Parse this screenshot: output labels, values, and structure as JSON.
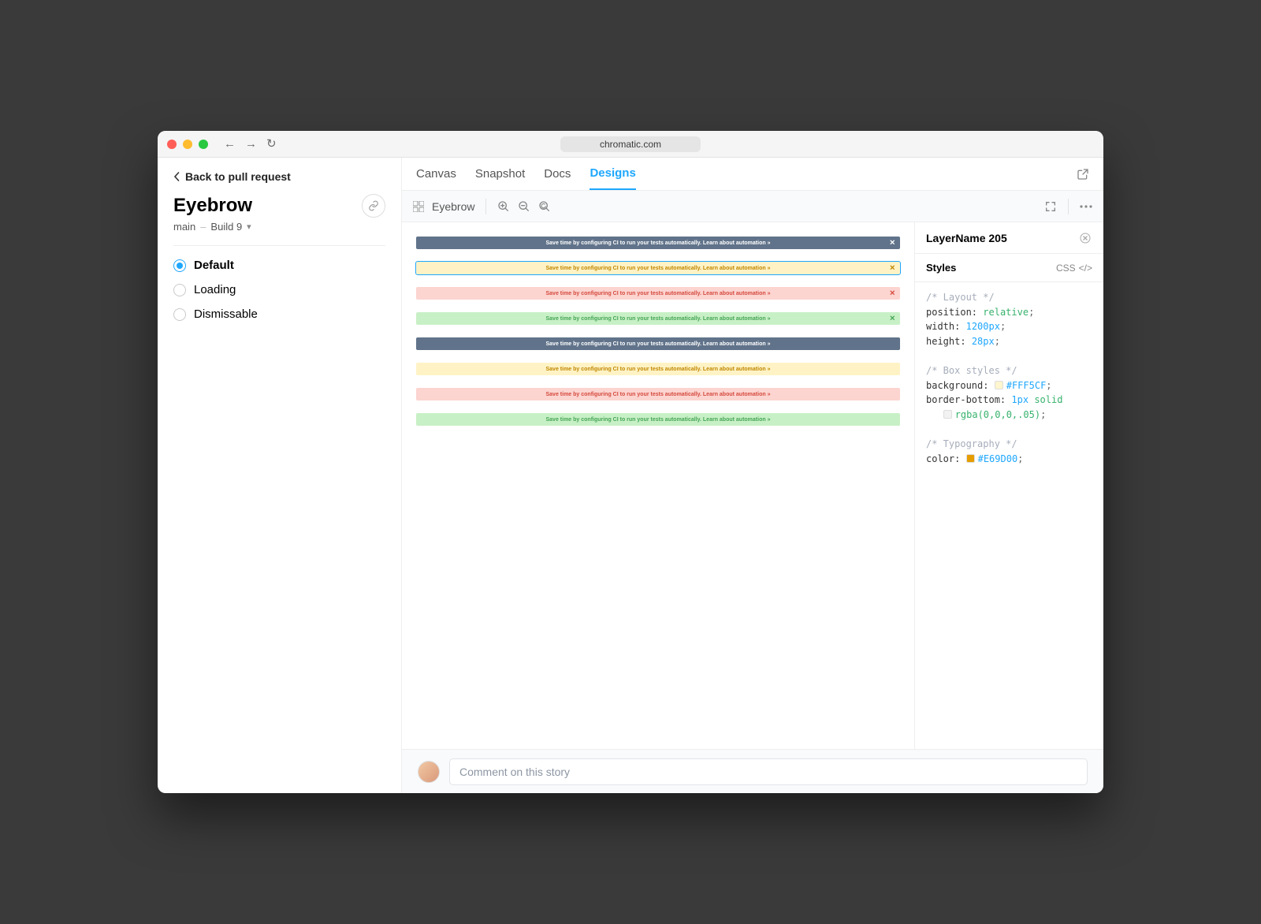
{
  "browser": {
    "url": "chromatic.com"
  },
  "sidebar": {
    "back_label": "Back to pull request",
    "title": "Eyebrow",
    "breadcrumb": {
      "branch": "main",
      "build": "Build 9"
    },
    "variants": [
      {
        "label": "Default",
        "selected": true
      },
      {
        "label": "Loading",
        "selected": false
      },
      {
        "label": "Dismissable",
        "selected": false
      }
    ]
  },
  "tabs": [
    {
      "label": "Canvas",
      "active": false
    },
    {
      "label": "Snapshot",
      "active": false
    },
    {
      "label": "Docs",
      "active": false
    },
    {
      "label": "Designs",
      "active": true
    }
  ],
  "toolbar": {
    "component_name": "Eyebrow"
  },
  "bars_text": "Save time by configuring CI to run your tests automatically. Learn about automation »",
  "bars": [
    {
      "variant": "gray",
      "dismissable": true,
      "selected": false
    },
    {
      "variant": "yellow",
      "dismissable": true,
      "selected": true
    },
    {
      "variant": "red",
      "dismissable": true,
      "selected": false
    },
    {
      "variant": "green",
      "dismissable": true,
      "selected": false
    },
    {
      "variant": "gray",
      "dismissable": false,
      "selected": false
    },
    {
      "variant": "yellow",
      "dismissable": false,
      "selected": false
    },
    {
      "variant": "red",
      "dismissable": false,
      "selected": false
    },
    {
      "variant": "green",
      "dismissable": false,
      "selected": false
    }
  ],
  "inspector": {
    "layer_name": "LayerName 205",
    "section": "Styles",
    "format_label": "CSS",
    "css": {
      "layout_comment": "/* Layout */",
      "position_prop": "position:",
      "position_val": "relative",
      "width_prop": "width:",
      "width_val": "1200px",
      "height_prop": "height:",
      "height_val": "28px",
      "box_comment": "/* Box styles */",
      "background_prop": "background:",
      "background_val": "#FFF5CF",
      "background_swatch": "#FFF5CF",
      "border_prop": "border-bottom:",
      "border_val_num": "1px",
      "border_val_kw": "solid",
      "border_color_val": "rgba(0,0,0,.05)",
      "border_swatch": "#f2f2f2",
      "typo_comment": "/* Typography */",
      "color_prop": "color:",
      "color_val": "#E69D00",
      "color_swatch": "#E69D00"
    }
  },
  "footer": {
    "comment_placeholder": "Comment on this story"
  }
}
